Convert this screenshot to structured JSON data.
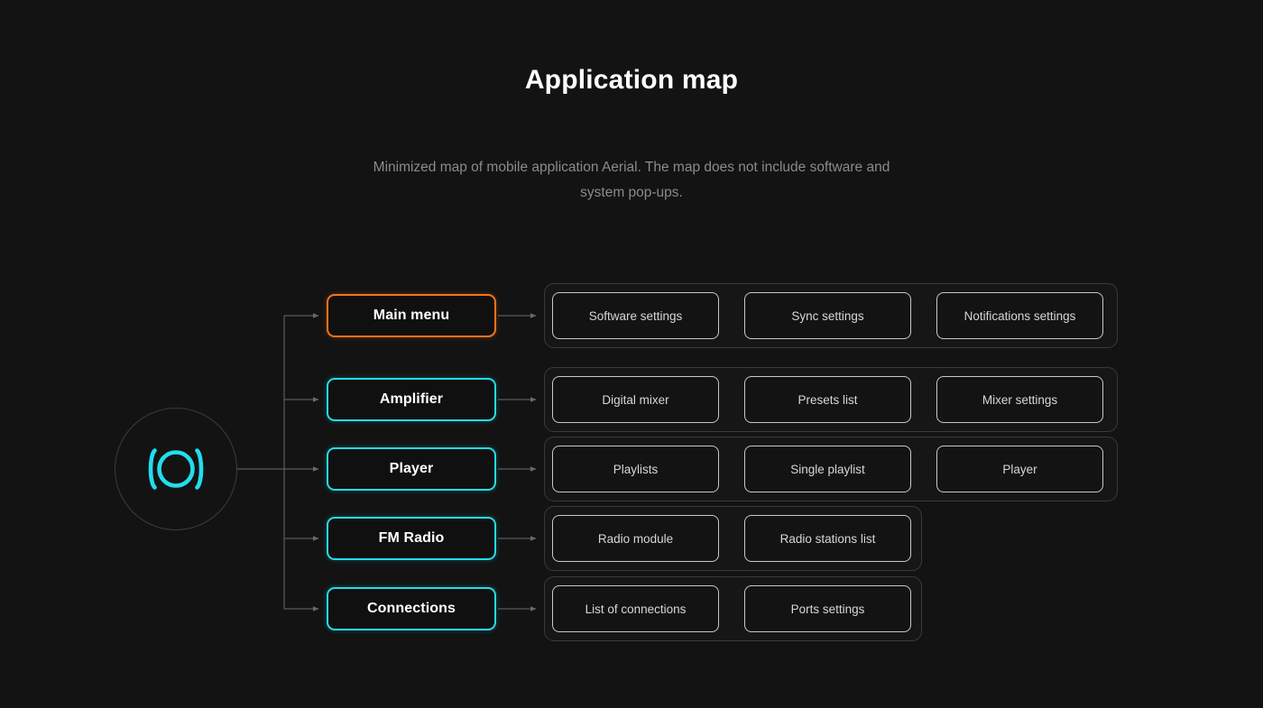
{
  "header": {
    "title": "Application map",
    "subtitle": "Minimized map of mobile application Aerial. The map does not include software and system pop-ups."
  },
  "colors": {
    "background": "#131313",
    "accent_orange": "#F97316",
    "accent_cyan": "#22DDEE",
    "group_border": "#3A3A3A",
    "subnode_border": "#C9C9C9",
    "connector": "#5A5A5A",
    "title_text": "#FFFFFF",
    "subtitle_text": "#8B8B8B",
    "subnode_text": "#D7D7D7"
  },
  "logo": {
    "icon": "aerial-logo-icon",
    "color": "#22DDEE",
    "circle_border": "#3C3C3C"
  },
  "diagram": {
    "type": "tree",
    "root": "aerial-logo-icon",
    "branches": [
      {
        "id": "main-menu",
        "label": "Main menu",
        "accent": "orange",
        "accent_color": "#F97316",
        "children": [
          "Software settings",
          "Sync settings",
          "Notifications settings"
        ]
      },
      {
        "id": "amplifier",
        "label": "Amplifier",
        "accent": "cyan",
        "accent_color": "#22DDEE",
        "children": [
          "Digital mixer",
          "Presets list",
          "Mixer settings"
        ]
      },
      {
        "id": "player",
        "label": "Player",
        "accent": "cyan",
        "accent_color": "#22DDEE",
        "children": [
          "Playlists",
          "Single playlist",
          "Player"
        ]
      },
      {
        "id": "fm-radio",
        "label": "FM Radio",
        "accent": "cyan",
        "accent_color": "#22DDEE",
        "children": [
          "Radio module",
          "Radio stations list"
        ]
      },
      {
        "id": "connections",
        "label": "Connections",
        "accent": "cyan",
        "accent_color": "#22DDEE",
        "children": [
          "List of connections",
          "Ports settings"
        ]
      }
    ]
  }
}
